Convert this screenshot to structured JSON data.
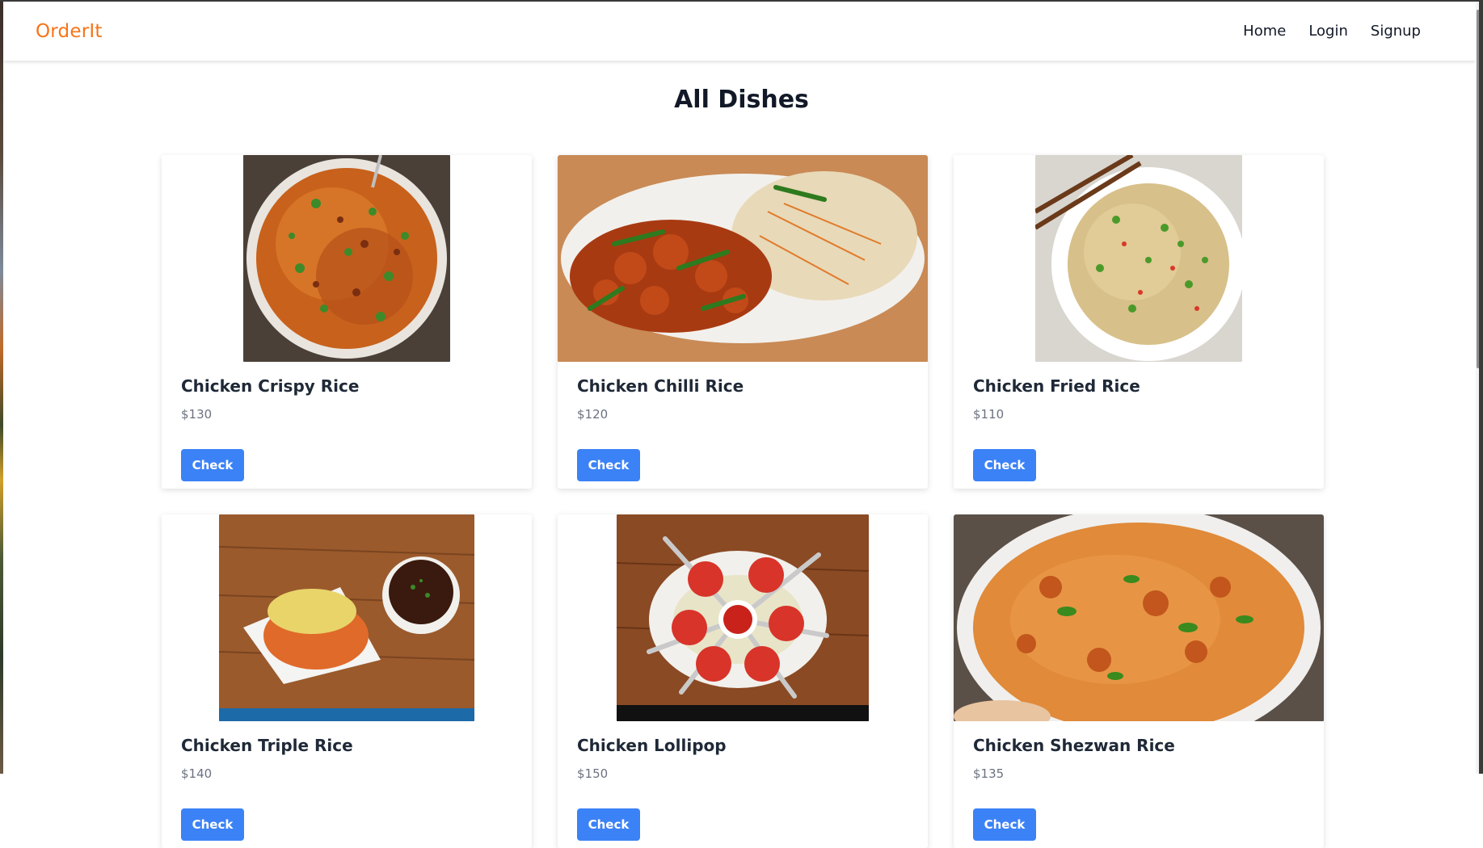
{
  "brand": "OrderIt",
  "nav": {
    "home": "Home",
    "login": "Login",
    "signup": "Signup"
  },
  "page_title": "All Dishes",
  "colors": {
    "brand": "#f97316",
    "button": "#3b82f6"
  },
  "dishes": [
    {
      "name": "Chicken Crispy Rice",
      "price": "$130",
      "button": "Check"
    },
    {
      "name": "Chicken Chilli Rice",
      "price": "$120",
      "button": "Check"
    },
    {
      "name": "Chicken Fried Rice",
      "price": "$110",
      "button": "Check"
    },
    {
      "name": "Chicken Triple Rice",
      "price": "$140",
      "button": "Check"
    },
    {
      "name": "Chicken Lollipop",
      "price": "$150",
      "button": "Check"
    },
    {
      "name": "Chicken Shezwan Rice",
      "price": "$135",
      "button": "Check"
    }
  ]
}
